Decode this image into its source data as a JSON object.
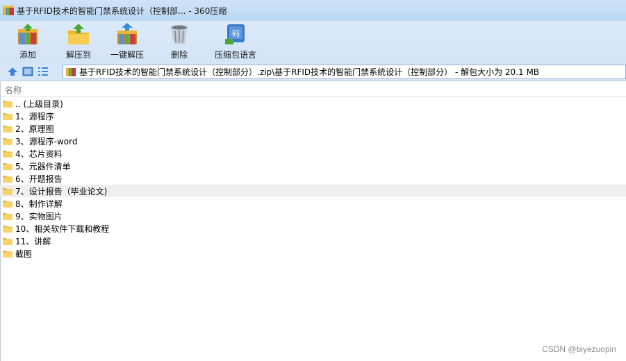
{
  "window": {
    "title": "基于RFID技术的智能门禁系统设计（控制部... - 360压缩"
  },
  "toolbar": {
    "buttons": [
      {
        "label": "添加",
        "icon": "add-archive-icon"
      },
      {
        "label": "解压到",
        "icon": "extract-to-icon"
      },
      {
        "label": "一键解压",
        "icon": "one-click-extract-icon"
      },
      {
        "label": "删除",
        "icon": "delete-icon"
      },
      {
        "label": "压缩包语言",
        "icon": "archive-language-icon"
      }
    ]
  },
  "address": {
    "path": "基于RFID技术的智能门禁系统设计（控制部分）.zip\\基于RFID技术的智能门禁系统设计（控制部分） - 解包大小为 20.1 MB"
  },
  "list": {
    "column_name": "名称",
    "items": [
      {
        "name": ".. (上级目录)"
      },
      {
        "name": "1、源程序"
      },
      {
        "name": "2、原理图"
      },
      {
        "name": "3、源程序-word"
      },
      {
        "name": "4、芯片资料"
      },
      {
        "name": "5、元器件清单"
      },
      {
        "name": "6、开题报告"
      },
      {
        "name": "7、设计报告（毕业论文)"
      },
      {
        "name": "8、制作详解"
      },
      {
        "name": "9、实物图片"
      },
      {
        "name": "10、相关软件下载和教程"
      },
      {
        "name": "11、讲解"
      },
      {
        "name": "截图"
      }
    ],
    "selected_index": 7
  },
  "watermark": "CSDN @biyezuopin",
  "colors": {
    "titlebar": "#c7ddf6",
    "toolbar": "#d6e6f7",
    "folder": "#f6d36b",
    "selected_row": "#efefef"
  }
}
